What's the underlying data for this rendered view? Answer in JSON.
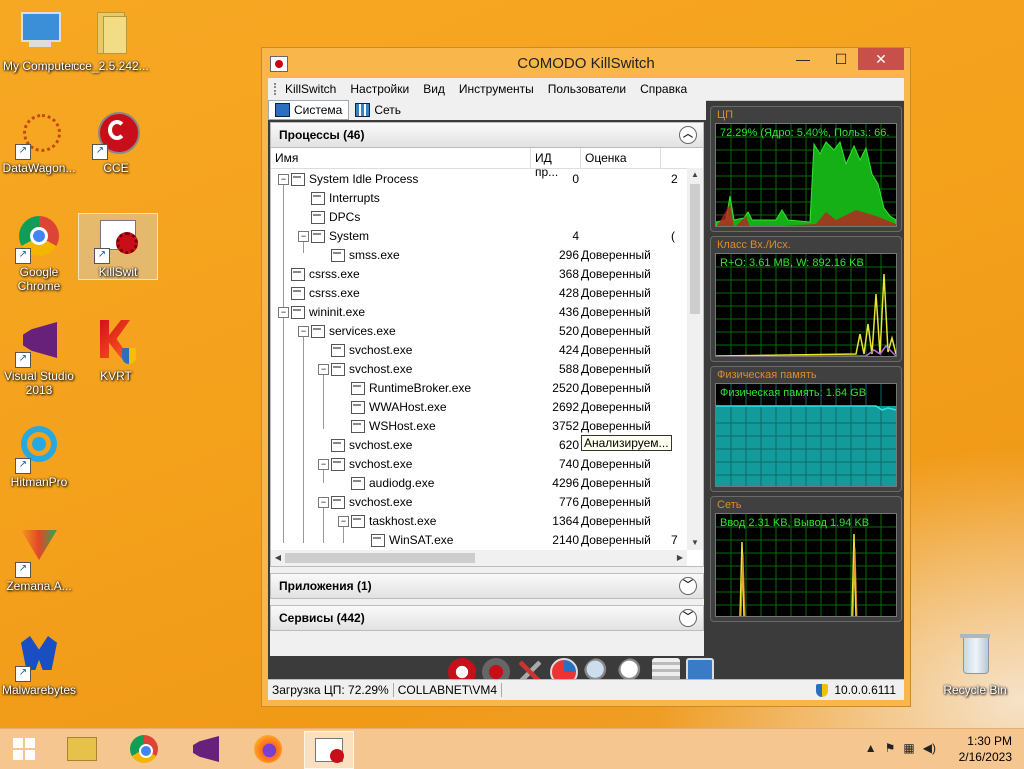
{
  "desktop": {
    "icons": [
      {
        "label": "My Computer"
      },
      {
        "label": "cce_2.5.242..."
      },
      {
        "label": "DataWagon..."
      },
      {
        "label": "CCE"
      },
      {
        "label": "Google Chrome"
      },
      {
        "label": "KillSwit"
      },
      {
        "label": "Visual Studio 2013"
      },
      {
        "label": "KVRT"
      },
      {
        "label": "HitmanPro"
      },
      {
        "label": "Zemana.A..."
      },
      {
        "label": "Malwarebytes"
      },
      {
        "label": "Recycle Bin"
      }
    ]
  },
  "window": {
    "title": "COMODO KillSwitch",
    "minimize": "—",
    "maximize": "☐",
    "close": "✕"
  },
  "menu": [
    "KillSwitch",
    "Настройки",
    "Вид",
    "Инструменты",
    "Пользователи",
    "Справка"
  ],
  "tabs": [
    {
      "label": "Система"
    },
    {
      "label": "Сеть"
    }
  ],
  "processes": {
    "header": "Процессы (46)",
    "columns": {
      "name": "Имя",
      "pid": "ИД пр...",
      "rating": "Оценка"
    },
    "rows": [
      {
        "name": "System Idle Process",
        "pid": "0",
        "rating": "",
        "extra": "2"
      },
      {
        "name": "Interrupts",
        "pid": "",
        "rating": "",
        "extra": ""
      },
      {
        "name": "DPCs",
        "pid": "",
        "rating": "",
        "extra": ""
      },
      {
        "name": "System",
        "pid": "4",
        "rating": "",
        "extra": "("
      },
      {
        "name": "smss.exe",
        "pid": "296",
        "rating": "Доверенный",
        "extra": ""
      },
      {
        "name": "csrss.exe",
        "pid": "368",
        "rating": "Доверенный",
        "extra": ""
      },
      {
        "name": "csrss.exe",
        "pid": "428",
        "rating": "Доверенный",
        "extra": ""
      },
      {
        "name": "wininit.exe",
        "pid": "436",
        "rating": "Доверенный",
        "extra": ""
      },
      {
        "name": "services.exe",
        "pid": "520",
        "rating": "Доверенный",
        "extra": ""
      },
      {
        "name": "svchost.exe",
        "pid": "424",
        "rating": "Доверенный",
        "extra": ""
      },
      {
        "name": "svchost.exe",
        "pid": "588",
        "rating": "Доверенный",
        "extra": ""
      },
      {
        "name": "RuntimeBroker.exe",
        "pid": "2520",
        "rating": "Доверенный",
        "extra": ""
      },
      {
        "name": "WWAHost.exe",
        "pid": "2692",
        "rating": "Доверенный",
        "extra": ""
      },
      {
        "name": "WSHost.exe",
        "pid": "3752",
        "rating": "Доверенный",
        "extra": ""
      },
      {
        "name": "svchost.exe",
        "pid": "620",
        "rating": "Анализируем...",
        "extra": ""
      },
      {
        "name": "svchost.exe",
        "pid": "740",
        "rating": "Доверенный",
        "extra": ""
      },
      {
        "name": "audiodg.exe",
        "pid": "4296",
        "rating": "Доверенный",
        "extra": ""
      },
      {
        "name": "svchost.exe",
        "pid": "776",
        "rating": "Доверенный",
        "extra": ""
      },
      {
        "name": "taskhost.exe",
        "pid": "1364",
        "rating": "Доверенный",
        "extra": ""
      },
      {
        "name": "WinSAT.exe",
        "pid": "2140",
        "rating": "Доверенный",
        "extra": "7"
      }
    ]
  },
  "applications": {
    "header": "Приложения (1)"
  },
  "services": {
    "header": "Сервисы (442)"
  },
  "graphs": {
    "cpu": {
      "title": "ЦП",
      "text": "72.29% (Ядро: 5.40%, Польз.: 66."
    },
    "io": {
      "title": "Класс Вх./Исх.",
      "text": "R+O: 3.61 MB, W: 892.16 KB"
    },
    "mem": {
      "title": "Физическая память",
      "text": "Физическая память: 1.64 GB"
    },
    "net": {
      "title": "Сеть",
      "text": "Ввод 2.31 KB, Вывод 1.94 KB"
    }
  },
  "status": {
    "cpu_load": "Загрузка ЦП: 72.29%",
    "user": "COLLABNET\\VM4",
    "ip": "10.0.0.6111"
  },
  "taskbar": {
    "time": "1:30 PM",
    "date": "2/16/2023",
    "tray_caret": "▲"
  },
  "colors": {
    "accent": "#f9b64b",
    "graph_line": "#2fe42f",
    "graph_label": "#e08a2a"
  }
}
